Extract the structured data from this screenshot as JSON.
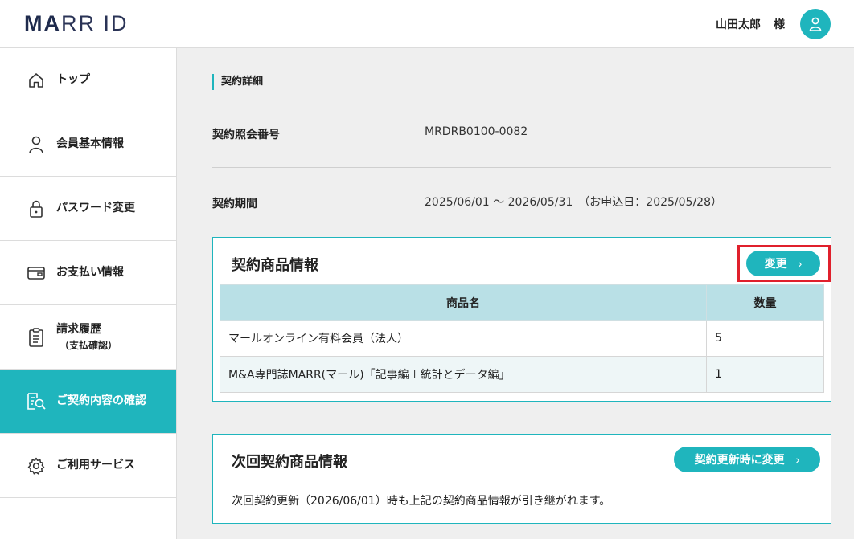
{
  "header": {
    "logo_strong": "MA",
    "logo_rest": "RR ID",
    "user_name": "山田太郎",
    "user_suffix": "様"
  },
  "sidebar": {
    "items": [
      {
        "label": "トップ",
        "icon": "home-icon"
      },
      {
        "label": "会員基本情報",
        "icon": "person-icon"
      },
      {
        "label": "パスワード変更",
        "icon": "lock-icon"
      },
      {
        "label": "お支払い情報",
        "icon": "wallet-icon"
      },
      {
        "label": "請求履歴",
        "sub": "（支払確認）",
        "icon": "clipboard-icon"
      },
      {
        "label": "ご契約内容の確認",
        "icon": "document-search-icon",
        "active": true
      },
      {
        "label": "ご利用サービス",
        "icon": "gear-icon"
      }
    ]
  },
  "contract": {
    "section_title": "契約詳細",
    "ref_label": "契約照会番号",
    "ref_value": "MRDRB0100-0082",
    "period_label": "契約期間",
    "period_value": "2025/06/01 〜 2026/05/31　（お申込日：2025/05/28）"
  },
  "product_card": {
    "title": "契約商品情報",
    "change_button": "変更",
    "columns": [
      "商品名",
      "数量"
    ],
    "rows": [
      {
        "name": "マールオンライン有料会員（法人）",
        "qty": "5"
      },
      {
        "name": "M&A専門誌MARR(マール)「記事編＋統計とデータ編」",
        "qty": "1"
      }
    ]
  },
  "next_card": {
    "title": "次回契約商品情報",
    "button": "契約更新時に変更",
    "note": "次回契約更新（2026/06/01）時も上記の契約商品情報が引き継がれます。"
  },
  "colors": {
    "accent": "#1fb5bd",
    "table_header": "#b9e0e6",
    "highlight": "#e0202c"
  }
}
